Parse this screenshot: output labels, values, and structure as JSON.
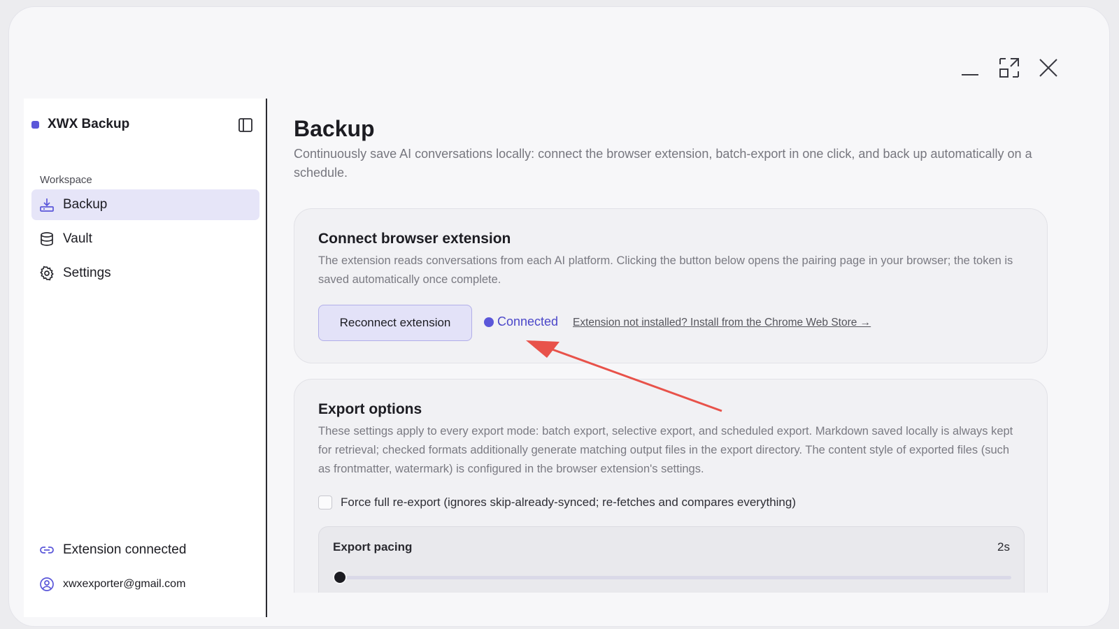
{
  "app": {
    "name": "XWX Backup",
    "brand_color": "#5b57d9"
  },
  "window_controls": [
    "minimize-icon",
    "maximize-icon",
    "close-icon"
  ],
  "sidebar": {
    "section_label": "Workspace",
    "items": [
      {
        "label": "Backup",
        "icon": "download-tray-icon",
        "active": true
      },
      {
        "label": "Vault",
        "icon": "database-icon",
        "active": false
      },
      {
        "label": "Settings",
        "icon": "gear-icon",
        "active": false
      }
    ],
    "footer": {
      "extension_status": "Extension connected",
      "account_email": "xwxexporter@gmail.com"
    }
  },
  "main": {
    "title": "Backup",
    "description": "Continuously save AI conversations locally: connect the browser extension, batch-export in one click, and back up automatically on a schedule.",
    "connect_card": {
      "title": "Connect browser extension",
      "description": "The extension reads conversations from each AI platform. Clicking the button below opens the pairing page in your browser; the token is saved automatically once complete.",
      "button_label": "Reconnect extension",
      "status_label": "Connected",
      "install_link": "Extension not installed? Install from the Chrome Web Store →"
    },
    "export_card": {
      "title": "Export options",
      "description": "These settings apply to every export mode: batch export, selective export, and scheduled export. Markdown saved locally is always kept for retrieval; checked formats additionally generate matching output files in the export directory. The content style of exported files (such as frontmatter, watermark) is configured in the browser extension's settings.",
      "force_reexport_label": "Force full re-export (ignores skip-already-synced; re-fetches and compares everything)",
      "force_reexport_checked": false,
      "pacing": {
        "label": "Export pacing",
        "value_label": "2s",
        "slider_fraction": 0
      }
    }
  },
  "annotation_color": "#e8524a"
}
